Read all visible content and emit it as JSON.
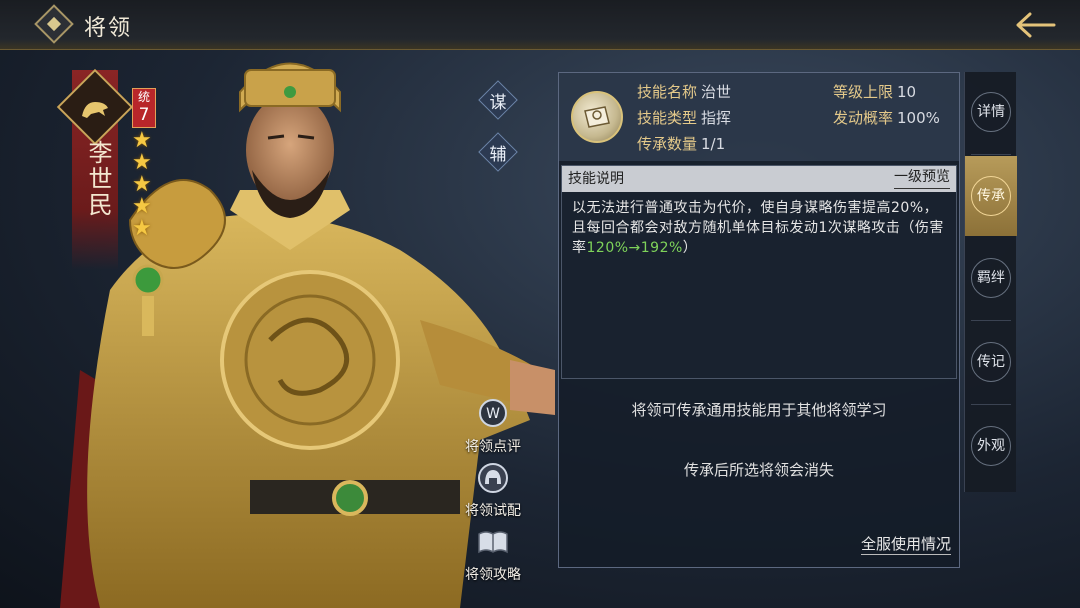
{
  "header": {
    "title": "将领"
  },
  "hero": {
    "name": "李世民",
    "stat_label": "统",
    "stat_value": "7",
    "stars": 5
  },
  "skill_tags": [
    "谋",
    "辅"
  ],
  "side_actions": [
    {
      "label": "将领点评",
      "icon": "review-icon"
    },
    {
      "label": "将领试配",
      "icon": "helmet-icon"
    },
    {
      "label": "将领攻略",
      "icon": "book-icon"
    }
  ],
  "skill": {
    "name_label": "技能名称",
    "name": "治世",
    "type_label": "技能类型",
    "type": "指挥",
    "count_label": "传承数量",
    "count": "1/1",
    "max_level_label": "等级上限",
    "max_level": "10",
    "trigger_label": "发动概率",
    "trigger": "100%",
    "desc_title": "技能说明",
    "preview_label": "一级预览",
    "desc_main": "以无法进行普通攻击为代价，使自身谋略伤害提高20%，且每回合都会对敌方随机单体目标发动1次谋略攻击（伤害率",
    "desc_highlight": "120%→192%",
    "desc_end": "）"
  },
  "notes": {
    "line1": "将领可传承通用技能用于其他将领学习",
    "line2": "传承后所选将领会消失",
    "server_usage": "全服使用情况"
  },
  "tabs": [
    {
      "label": "详情",
      "active": false
    },
    {
      "label": "传承",
      "active": true
    },
    {
      "label": "羁绊",
      "active": false
    },
    {
      "label": "传记",
      "active": false
    },
    {
      "label": "外观",
      "active": false
    }
  ]
}
